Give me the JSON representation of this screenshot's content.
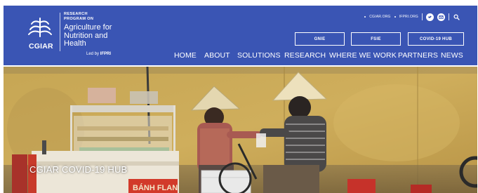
{
  "brand": {
    "logo_text": "CGIAR",
    "program_top": "RESEARCH PROGRAM ON",
    "program_name": "Agriculture for Nutrition and Health",
    "led_by_prefix": "Led by",
    "led_by_org": "IFPRI"
  },
  "utility": {
    "links": [
      "CGIAR.ORG",
      "IFPRI.ORG"
    ],
    "icons": [
      "twitter-icon",
      "email-icon",
      "search-icon"
    ]
  },
  "pills": {
    "gnie": "GNIE",
    "fsie": "FSIE",
    "covid": "COVID-19 HUB"
  },
  "nav": {
    "items": [
      "HOME",
      "ABOUT",
      "SOLUTIONS",
      "RESEARCH",
      "WHERE WE WORK",
      "PARTNERS",
      "NEWS"
    ]
  },
  "hero": {
    "caption": "CGIAR COVID-19 HUB",
    "sign_text": "BÁNH FLAN"
  },
  "colors": {
    "header_bg": "#3a55b4",
    "wall": "#c8a95a",
    "text_light": "#ffffff"
  }
}
